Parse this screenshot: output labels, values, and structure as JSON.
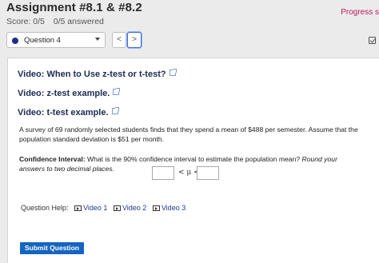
{
  "header": {
    "title": "Assignment #8.1 & #8.2",
    "score": "Score: 0/5",
    "answered": "0/5 answered",
    "progress_label": "Progress s"
  },
  "question_nav": {
    "selected_question": "Question 4",
    "prev_symbol": "<",
    "next_symbol": ">"
  },
  "video_links": [
    "Video: When to Use z-test or t-test?",
    "Video: z-test example.",
    "Video: t-test example."
  ],
  "problem": {
    "text": "A survey of 69 randomly selected students finds that they spend a mean of $488 per semester. Assume that the population standard deviation is $51 per month.",
    "ci_label": "Confidence Interval:",
    "ci_question": " What is the 90% confidence interval to estimate the population mean? ",
    "ci_instruction": "Round your answers to two decimal places.",
    "inequality_text": "< μ <",
    "lower_value": "",
    "upper_value": ""
  },
  "help": {
    "label": "Question Help:",
    "items": [
      "Video 1",
      "Video 2",
      "Video 3"
    ]
  },
  "submit_label": "Submit Question",
  "colors": {
    "progress_text": "#c2185b",
    "question_dot": "#1f2d8a",
    "submit_bg": "#1565c0",
    "link_text": "#1b2a55"
  }
}
